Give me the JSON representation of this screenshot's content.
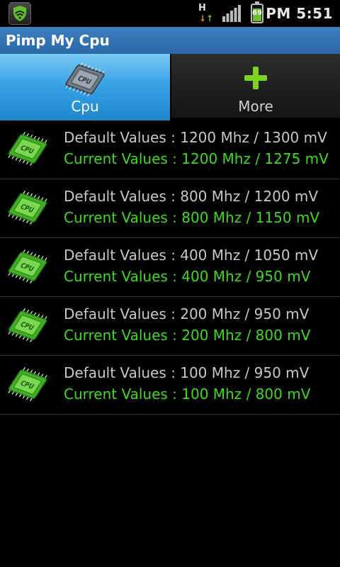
{
  "status_bar": {
    "network_type": "H",
    "battery_level": "69",
    "time": "PM 5:51",
    "icons": [
      "shield-icon",
      "data-activity-icon",
      "signal-bars-icon",
      "battery-icon"
    ]
  },
  "app": {
    "title": "Pimp My Cpu"
  },
  "tabs": [
    {
      "label": "Cpu",
      "icon": "cpu-chip-icon",
      "selected": true
    },
    {
      "label": "More",
      "icon": "plus-icon",
      "selected": false
    }
  ],
  "frequencies": [
    {
      "default": "Default Values : 1200 Mhz / 1300 mV",
      "current": "Current Values : 1200 Mhz / 1275 mV"
    },
    {
      "default": "Default Values : 800 Mhz / 1200 mV",
      "current": "Current Values : 800 Mhz / 1150 mV"
    },
    {
      "default": "Default Values : 400 Mhz / 1050 mV",
      "current": "Current Values : 400 Mhz / 950 mV"
    },
    {
      "default": "Default Values : 200 Mhz / 950 mV",
      "current": "Current Values : 200 Mhz / 800 mV"
    },
    {
      "default": "Default Values : 100 Mhz / 950 mV",
      "current": "Current Values : 100 Mhz / 800 mV"
    }
  ],
  "colors": {
    "title_bar": "#2f72b3",
    "selected_tab": "#39a2e5",
    "current_values_text": "#3bdc1c",
    "default_values_text": "#c8c8c8",
    "plus_icon": "#7ed321"
  },
  "chip_label": "CPU"
}
